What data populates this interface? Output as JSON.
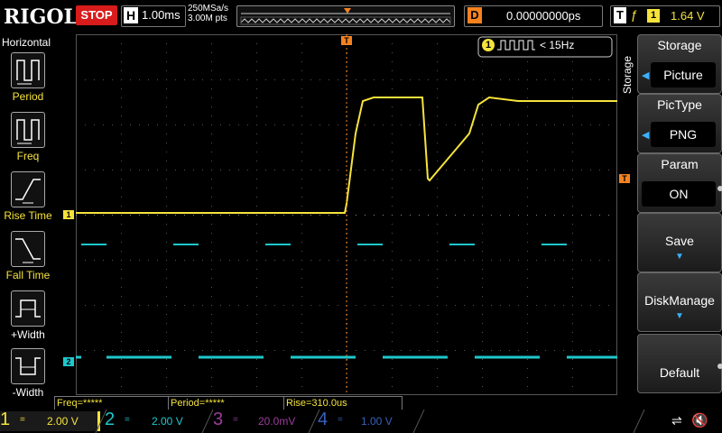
{
  "header": {
    "brand": "RIGOL",
    "run_state": "STOP",
    "timebase_label": "H",
    "timebase_value": "1.00ms",
    "sample_rate": "250MSa/s",
    "memory_depth": "3.00M pts",
    "delay_label": "D",
    "delay_value": "0.00000000ps",
    "trigger_label": "T",
    "trigger_channel": "1",
    "trigger_level": "1.64 V"
  },
  "left_panel": {
    "title": "Horizontal",
    "items": [
      {
        "label": "Period"
      },
      {
        "label": "Freq"
      },
      {
        "label": "Rise Time"
      },
      {
        "label": "Fall Time"
      },
      {
        "label": "+Width"
      },
      {
        "label": "-Width"
      }
    ]
  },
  "freq_counter": {
    "channel": "1",
    "value": "< 15Hz"
  },
  "markers": {
    "ch1": "1",
    "ch2": "2",
    "trigger_top": "T",
    "trigger_level": "T"
  },
  "menu": {
    "tab": "Storage",
    "title": "Storage",
    "items": [
      {
        "title": "Storage",
        "value": "Picture"
      },
      {
        "title": "PicType",
        "value": "PNG"
      },
      {
        "title": "Param",
        "value": "ON"
      },
      {
        "title": "Save"
      },
      {
        "title": "DiskManage"
      },
      {
        "title": "Default"
      }
    ]
  },
  "measurements": {
    "freq": "Freq=*****",
    "period": "Period=*****",
    "rise": "Rise=310.0us"
  },
  "channels": [
    {
      "num": "1",
      "coupling": "=",
      "scale": "2.00 V"
    },
    {
      "num": "2",
      "coupling": "=",
      "scale": "2.00 V"
    },
    {
      "num": "3",
      "coupling": "=",
      "scale": "20.0mV"
    },
    {
      "num": "4",
      "coupling": "=",
      "scale": "1.00 V"
    }
  ],
  "colors": {
    "ch1": "#f5e33c",
    "ch2": "#1ec8cc",
    "ch3": "#9b3c9b",
    "ch4": "#3a5fbf",
    "trigger": "#f5821f",
    "stop": "#d81b1b",
    "accent": "#3ab0ff"
  },
  "icons": [
    "usb-icon",
    "speaker-mute-icon"
  ]
}
